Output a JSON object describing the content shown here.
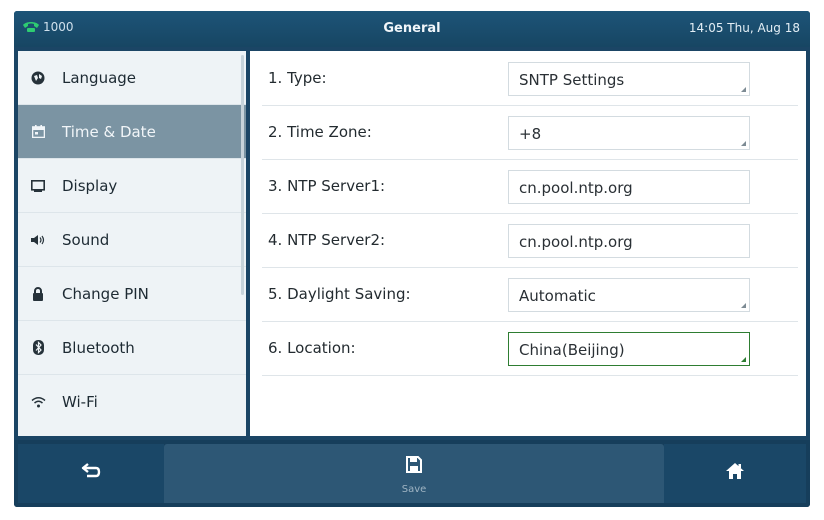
{
  "topbar": {
    "line": "1000",
    "title": "General",
    "clock": "14:05 Thu, Aug 18"
  },
  "sidebar": {
    "items": [
      {
        "label": "Language",
        "icon": "globe-icon"
      },
      {
        "label": "Time & Date",
        "icon": "calendar-icon",
        "active": true
      },
      {
        "label": "Display",
        "icon": "display-icon"
      },
      {
        "label": "Sound",
        "icon": "speaker-icon"
      },
      {
        "label": "Change PIN",
        "icon": "lock-icon"
      },
      {
        "label": "Bluetooth",
        "icon": "bluetooth-icon"
      },
      {
        "label": "Wi-Fi",
        "icon": "wifi-icon"
      }
    ]
  },
  "settings": [
    {
      "label": "1. Type:",
      "value": "SNTP Settings",
      "dropdown": true
    },
    {
      "label": "2. Time Zone:",
      "value": "+8",
      "dropdown": true
    },
    {
      "label": "3. NTP Server1:",
      "value": "cn.pool.ntp.org"
    },
    {
      "label": "4. NTP Server2:",
      "value": "cn.pool.ntp.org"
    },
    {
      "label": "5. Daylight Saving:",
      "value": "Automatic",
      "dropdown": true
    },
    {
      "label": "6. Location:",
      "value": "China(Beijing)",
      "dropdown": true,
      "focused": true
    }
  ],
  "softkeys": {
    "back_icon": "back-arrow-icon",
    "save_label": "Save",
    "save_icon": "floppy-disk-icon",
    "home_icon": "home-icon"
  },
  "colors": {
    "header": "#1d5478",
    "sidebar_active": "#7b94a3",
    "focus": "#2e7d32"
  }
}
